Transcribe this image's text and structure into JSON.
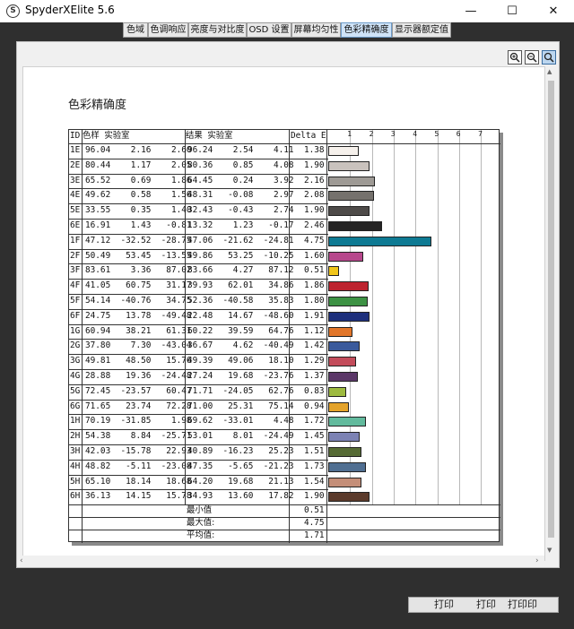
{
  "window": {
    "title": "SpyderXElite 5.6",
    "icon_glyph": "S",
    "controls": {
      "minimize": "—",
      "maximize": "☐",
      "close": "✕"
    }
  },
  "tabs": [
    {
      "label": "色域",
      "active": false
    },
    {
      "label": "色调响应",
      "active": false
    },
    {
      "label": "亮度与对比度",
      "active": false
    },
    {
      "label": "OSD 设置",
      "active": false
    },
    {
      "label": "屏幕均匀性",
      "active": false
    },
    {
      "label": "色彩精确度",
      "active": true
    },
    {
      "label": "显示器额定值",
      "active": false
    }
  ],
  "zoom_icons": [
    "zoom-in-icon",
    "zoom-out-icon",
    "zoom-fit-icon"
  ],
  "report": {
    "title": "色彩精确度",
    "headers": {
      "id": "ID",
      "sample": "色样 实验室",
      "result": "结果 实验室",
      "delta": "Delta E"
    },
    "axis_ticks": [
      "1",
      "2",
      "3",
      "4",
      "5",
      "6",
      "7"
    ],
    "rows": [
      {
        "id": "1E",
        "sample": [
          "96.04",
          "2.16",
          "2.60"
        ],
        "result": [
          "96.24",
          "2.54",
          "4.11"
        ],
        "delta": "1.38",
        "color": "#f6f1ec"
      },
      {
        "id": "2E",
        "sample": [
          "80.44",
          "1.17",
          "2.05"
        ],
        "result": [
          "80.36",
          "0.85",
          "4.08"
        ],
        "delta": "1.90",
        "color": "#c9c2bd"
      },
      {
        "id": "3E",
        "sample": [
          "65.52",
          "0.69",
          "1.86"
        ],
        "result": [
          "64.45",
          "0.24",
          "3.92"
        ],
        "delta": "2.16",
        "color": "#9e9a95"
      },
      {
        "id": "4E",
        "sample": [
          "49.62",
          "0.58",
          "1.56"
        ],
        "result": [
          "48.31",
          "-0.08",
          "2.97"
        ],
        "delta": "2.08",
        "color": "#75716d"
      },
      {
        "id": "5E",
        "sample": [
          "33.55",
          "0.35",
          "1.40"
        ],
        "result": [
          "32.43",
          "-0.43",
          "2.74"
        ],
        "delta": "1.90",
        "color": "#4e4b49"
      },
      {
        "id": "6E",
        "sample": [
          "16.91",
          "1.43",
          "-0.81"
        ],
        "result": [
          "13.32",
          "1.23",
          "-0.17"
        ],
        "delta": "2.46",
        "color": "#252424"
      },
      {
        "id": "1F",
        "sample": [
          "47.12",
          "-32.52",
          "-28.75"
        ],
        "result": [
          "47.06",
          "-21.62",
          "-24.81"
        ],
        "delta": "4.75",
        "color": "#0e7a93"
      },
      {
        "id": "2F",
        "sample": [
          "50.49",
          "53.45",
          "-13.55"
        ],
        "result": [
          "49.86",
          "53.25",
          "-10.25"
        ],
        "delta": "1.60",
        "color": "#b7478c"
      },
      {
        "id": "3F",
        "sample": [
          "83.61",
          "3.36",
          "87.02"
        ],
        "result": [
          "83.66",
          "4.27",
          "87.12"
        ],
        "delta": "0.51",
        "color": "#f1c61a"
      },
      {
        "id": "4F",
        "sample": [
          "41.05",
          "60.75",
          "31.17"
        ],
        "result": [
          "39.93",
          "62.01",
          "34.86"
        ],
        "delta": "1.86",
        "color": "#bd232f"
      },
      {
        "id": "5F",
        "sample": [
          "54.14",
          "-40.76",
          "34.75"
        ],
        "result": [
          "52.36",
          "-40.58",
          "35.83"
        ],
        "delta": "1.80",
        "color": "#3d9244"
      },
      {
        "id": "6F",
        "sample": [
          "24.75",
          "13.78",
          "-49.48"
        ],
        "result": [
          "22.48",
          "14.67",
          "-48.60"
        ],
        "delta": "1.91",
        "color": "#1d2f7c"
      },
      {
        "id": "1G",
        "sample": [
          "60.94",
          "38.21",
          "61.31"
        ],
        "result": [
          "60.22",
          "39.59",
          "64.76"
        ],
        "delta": "1.12",
        "color": "#e2762a"
      },
      {
        "id": "2G",
        "sample": [
          "37.80",
          "7.30",
          "-43.04"
        ],
        "result": [
          "36.67",
          "4.62",
          "-40.49"
        ],
        "delta": "1.42",
        "color": "#3a5a9c"
      },
      {
        "id": "3G",
        "sample": [
          "49.81",
          "48.50",
          "15.76"
        ],
        "result": [
          "49.39",
          "49.06",
          "18.10"
        ],
        "delta": "1.29",
        "color": "#c34c5b"
      },
      {
        "id": "4G",
        "sample": [
          "28.88",
          "19.36",
          "-24.48"
        ],
        "result": [
          "27.24",
          "19.68",
          "-23.76"
        ],
        "delta": "1.37",
        "color": "#5b3768"
      },
      {
        "id": "5G",
        "sample": [
          "72.45",
          "-23.57",
          "60.47"
        ],
        "result": [
          "71.71",
          "-24.05",
          "62.76"
        ],
        "delta": "0.83",
        "color": "#9dba3f"
      },
      {
        "id": "6G",
        "sample": [
          "71.65",
          "23.74",
          "72.28"
        ],
        "result": [
          "71.00",
          "25.31",
          "75.14"
        ],
        "delta": "0.94",
        "color": "#e4a32a"
      },
      {
        "id": "1H",
        "sample": [
          "70.19",
          "-31.85",
          "1.98"
        ],
        "result": [
          "69.62",
          "-33.01",
          "4.48"
        ],
        "delta": "1.72",
        "color": "#62ba9d"
      },
      {
        "id": "2H",
        "sample": [
          "54.38",
          "8.84",
          "-25.71"
        ],
        "result": [
          "53.01",
          "8.01",
          "-24.49"
        ],
        "delta": "1.45",
        "color": "#7c82b4"
      },
      {
        "id": "3H",
        "sample": [
          "42.03",
          "-15.78",
          "22.93"
        ],
        "result": [
          "40.89",
          "-16.23",
          "25.23"
        ],
        "delta": "1.51",
        "color": "#566b35"
      },
      {
        "id": "4H",
        "sample": [
          "48.82",
          "-5.11",
          "-23.08"
        ],
        "result": [
          "47.35",
          "-5.65",
          "-21.23"
        ],
        "delta": "1.73",
        "color": "#506f92"
      },
      {
        "id": "5H",
        "sample": [
          "65.10",
          "18.14",
          "18.68"
        ],
        "result": [
          "64.20",
          "19.68",
          "21.13"
        ],
        "delta": "1.54",
        "color": "#c48e78"
      },
      {
        "id": "6H",
        "sample": [
          "36.13",
          "14.15",
          "15.78"
        ],
        "result": [
          "34.93",
          "13.60",
          "17.82"
        ],
        "delta": "1.90",
        "color": "#5b3a2b"
      }
    ],
    "summary": [
      {
        "label": "最小值",
        "value": "0.51"
      },
      {
        "label": "最大值:",
        "value": "4.75"
      },
      {
        "label": "平均值:",
        "value": "1.71"
      }
    ]
  },
  "buttons": {
    "print1": "打印",
    "print2": "打印",
    "print3": "打印印"
  }
}
